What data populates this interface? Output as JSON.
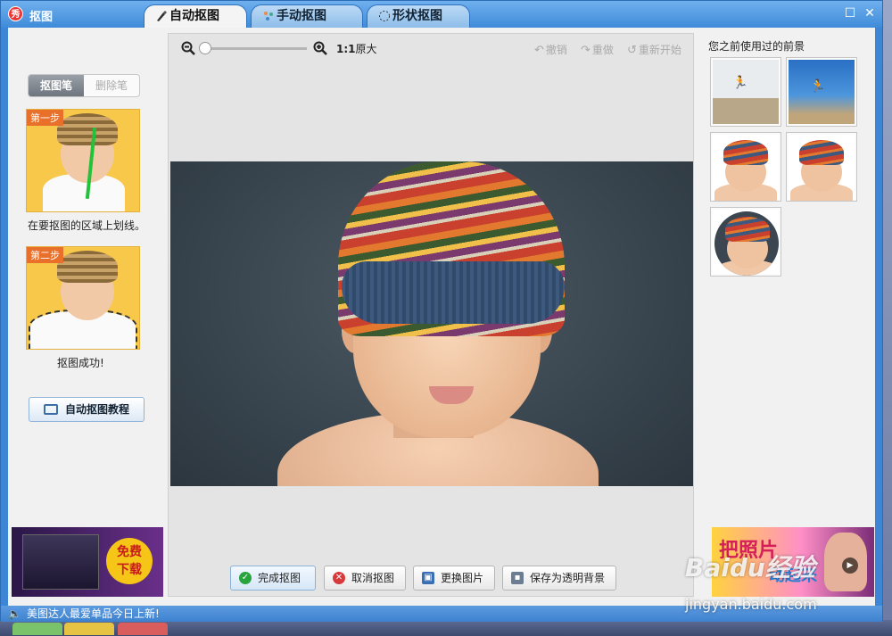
{
  "window": {
    "title": "抠图",
    "tabs": [
      {
        "label": "自动抠图",
        "icon": "brush-icon",
        "active": true
      },
      {
        "label": "手动抠图",
        "icon": "magic-wand-icon",
        "active": false
      },
      {
        "label": "形状抠图",
        "icon": "shape-dotted-icon",
        "active": false
      }
    ],
    "controls": {
      "maximize": "☐",
      "close": "✕"
    }
  },
  "left_panel": {
    "pen_toggle": {
      "active": "抠图笔",
      "inactive": "删除笔"
    },
    "step1": {
      "tag": "第一步",
      "caption": "在要抠图的区域上划线。"
    },
    "step2": {
      "tag": "第二步",
      "caption": "抠图成功!"
    },
    "tutorial_button": "自动抠图教程",
    "ad": {
      "line1": "免费",
      "line2": "下载"
    }
  },
  "toolbar": {
    "zoom_ratio": "1:1",
    "original_size": "原大",
    "undo": "撤销",
    "redo": "重做",
    "reset": "重新开始",
    "zoom_slider_value": 0
  },
  "bottom_buttons": {
    "finish": "完成抠图",
    "cancel": "取消抠图",
    "change": "更换图片",
    "save": "保存为透明背景"
  },
  "right_panel": {
    "title": "您之前使用过的前景"
  },
  "status": {
    "message": "美图达人最爱单品今日上新!"
  },
  "ad_right": {
    "line1": "把照片",
    "line2": "动起来"
  },
  "watermark": {
    "brand": "Baidu经验",
    "url": "jingyan.baidu.com"
  },
  "colors": {
    "titlebar": "#3f8bd9",
    "accent_orange": "#e8702a",
    "status_bar": "#3e82cf"
  }
}
